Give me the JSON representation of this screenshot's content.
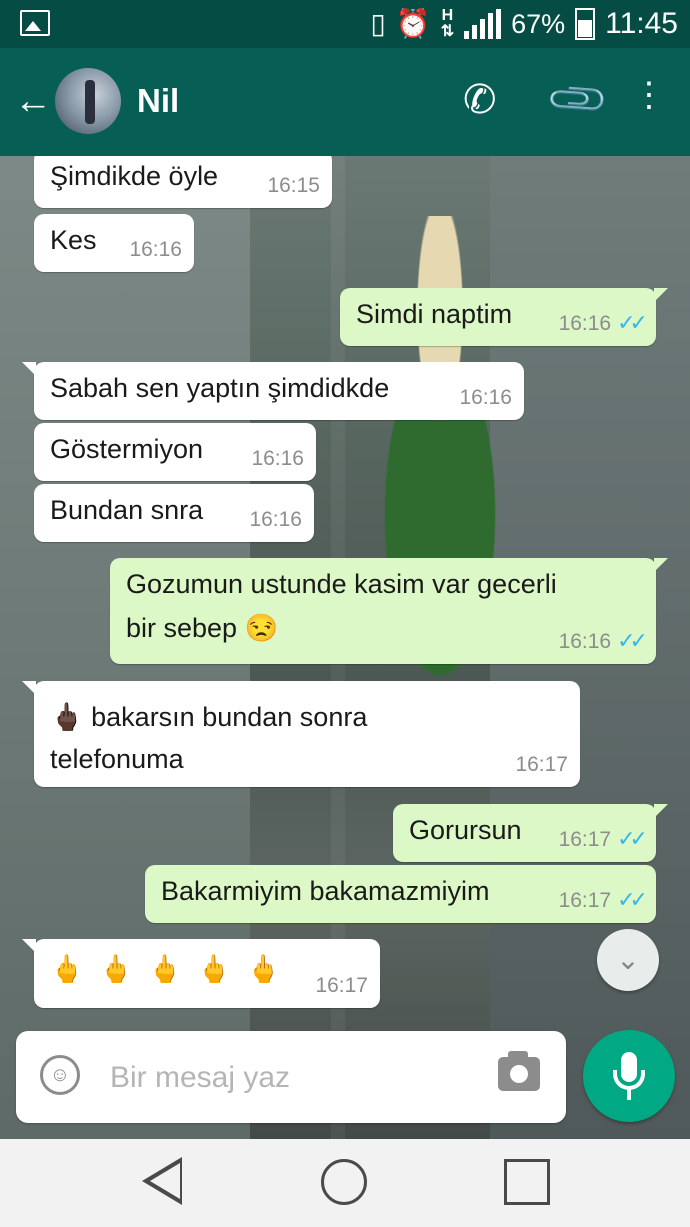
{
  "status_bar": {
    "battery": "67%",
    "time": "11:45",
    "network": "H",
    "battery_level": 0.67
  },
  "header": {
    "back_icon": "arrow-left-icon",
    "contact_name": "Nil",
    "call_icon": "phone-icon",
    "attach_icon": "paperclip-icon",
    "menu_icon": "more-vert-icon"
  },
  "messages": [
    {
      "dir": "in",
      "text": "Şimdikde öyle",
      "time": "16:15"
    },
    {
      "dir": "in",
      "text": "Kes",
      "time": "16:16"
    },
    {
      "dir": "out",
      "text": "Simdi naptim",
      "time": "16:16",
      "ticks": "✓✓"
    },
    {
      "dir": "in",
      "text": "Sabah sen yaptın şimdidkde",
      "time": "16:16"
    },
    {
      "dir": "in",
      "text": "Göstermiyon",
      "time": "16:16"
    },
    {
      "dir": "in",
      "text": "Bundan snra",
      "time": "16:16"
    },
    {
      "dir": "out",
      "line1": "Gozumun ustunde kasim var gecerli",
      "line2": "bir sebep",
      "emoji": "😒",
      "time": "16:16",
      "ticks": "✓✓"
    },
    {
      "dir": "in",
      "emoji": "🖕🏿",
      "line1": "bakarsın bundan sonra",
      "line2": "telefonuma",
      "time": "16:17"
    },
    {
      "dir": "out",
      "text": "Gorursun",
      "time": "16:17",
      "ticks": "✓✓"
    },
    {
      "dir": "out",
      "text": "Bakarmiyim bakamazmiyim",
      "time": "16:17",
      "ticks": "✓✓"
    },
    {
      "dir": "in",
      "text": "🖕 🖕 🖕 🖕 🖕",
      "time": "16:17"
    }
  ],
  "composer": {
    "placeholder": "Bir mesaj yaz",
    "emoji_icon": "smiley-icon",
    "camera_icon": "camera-icon",
    "mic_icon": "microphone-icon"
  },
  "scroll_button_icon": "double-chevron-down-icon",
  "nav": {
    "back_icon": "triangle-back-icon",
    "home_icon": "circle-home-icon",
    "recents_icon": "square-recents-icon"
  },
  "colors": {
    "header": "#075e54",
    "status_bar": "#054d44",
    "outgoing_bubble": "#dcf8c6",
    "incoming_bubble": "#ffffff",
    "mic_button": "#00a884",
    "read_ticks": "#34b7f1"
  }
}
